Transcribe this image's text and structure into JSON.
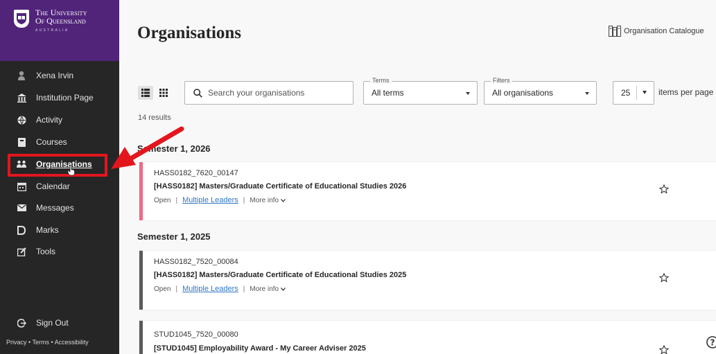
{
  "logo": {
    "line1": "The University",
    "line2": "Of Queensland",
    "line3": "AUSTRALIA"
  },
  "sidebar": {
    "items": [
      {
        "label": "Xena Irvin",
        "icon": "user-icon"
      },
      {
        "label": "Institution Page",
        "icon": "institution-icon"
      },
      {
        "label": "Activity",
        "icon": "globe-icon"
      },
      {
        "label": "Courses",
        "icon": "book-icon"
      },
      {
        "label": "Organisations",
        "icon": "people-icon",
        "active": true
      },
      {
        "label": "Calendar",
        "icon": "calendar-icon"
      },
      {
        "label": "Messages",
        "icon": "envelope-icon"
      },
      {
        "label": "Marks",
        "icon": "marks-icon"
      },
      {
        "label": "Tools",
        "icon": "tools-icon"
      }
    ],
    "sign_out": "Sign Out",
    "footer": "Privacy • Terms • Accessibility"
  },
  "header": {
    "title": "Organisations",
    "catalogue_label": "Organisation Catalogue"
  },
  "toolbar": {
    "search_placeholder": "Search your organisations",
    "terms": {
      "label": "Terms",
      "value": "All terms"
    },
    "filters": {
      "label": "Filters",
      "value": "All organisations"
    },
    "per_page": {
      "value": "25",
      "label": "items per page"
    },
    "results": "14 results"
  },
  "sections": [
    {
      "title": "Semester 1, 2026",
      "cards": [
        {
          "code": "HASS0182_7620_00147",
          "title": "[HASS0182] Masters/Graduate Certificate of Educational Studies 2026",
          "status": "Open",
          "leaders": "Multiple Leaders",
          "more": "More info",
          "accent": "#ed6b83"
        }
      ]
    },
    {
      "title": "Semester 1, 2025",
      "cards": [
        {
          "code": "HASS0182_7520_00084",
          "title": "[HASS0182] Masters/Graduate Certificate of Educational Studies 2025",
          "status": "Open",
          "leaders": "Multiple Leaders",
          "more": "More info",
          "accent": "#5a5a5a"
        },
        {
          "code": "STUD1045_7520_00080",
          "title": "[STUD1045] Employability Award - My Career Adviser 2025",
          "accent": "#5a5a5a"
        }
      ]
    }
  ],
  "colors": {
    "brand_purple": "#51247a",
    "sidebar_bg": "#262626",
    "highlight_red": "#e3161d",
    "link_blue": "#2f77c4"
  }
}
